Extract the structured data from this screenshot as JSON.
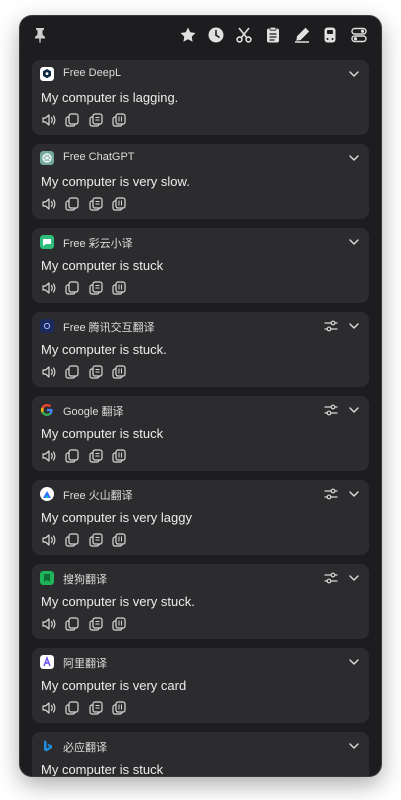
{
  "toolbar": {
    "icons": [
      "pin-icon",
      "star-icon",
      "history-icon",
      "scissors-icon",
      "clipboard-icon",
      "highlighter-icon",
      "bookmark-icon",
      "toggle-settings-icon"
    ]
  },
  "cards": [
    {
      "service": "Free DeepL",
      "logo": "deepl-logo",
      "logo_color": "#0f2b46",
      "has_settings": false,
      "text": "My computer is lagging."
    },
    {
      "service": "Free ChatGPT",
      "logo": "chatgpt-logo",
      "logo_color": "#74aa9c",
      "has_settings": false,
      "text": "My computer is very slow."
    },
    {
      "service": "Free 彩云小译",
      "logo": "caiyun-logo",
      "logo_color": "#2ebd7a",
      "has_settings": false,
      "text": "My computer is stuck"
    },
    {
      "service": "Free 腾讯交互翻译",
      "logo": "tencent-logo",
      "logo_color": "#1b2a5c",
      "has_settings": true,
      "text": "My computer is stuck."
    },
    {
      "service": "Google 翻译",
      "logo": "google-logo",
      "logo_color": "#4285f4",
      "has_settings": true,
      "text": "My computer is stuck"
    },
    {
      "service": "Free 火山翻译",
      "logo": "volcano-logo",
      "logo_color": "#3370ff",
      "has_settings": true,
      "text": "My computer is very laggy"
    },
    {
      "service": "搜狗翻译",
      "logo": "sogou-logo",
      "logo_color": "#1fb45a",
      "has_settings": true,
      "text": "My computer is very stuck."
    },
    {
      "service": "阿里翻译",
      "logo": "alibaba-logo",
      "logo_color": "#6b4ef2",
      "has_settings": false,
      "text": "My computer is very card"
    },
    {
      "service": "必应翻译",
      "logo": "bing-logo",
      "logo_color": "#1e8fe0",
      "has_settings": false,
      "text": "My computer is stuck"
    }
  ],
  "action_icons": [
    "speaker-icon",
    "copy-icon",
    "copy-source-icon",
    "copy-both-icon"
  ]
}
